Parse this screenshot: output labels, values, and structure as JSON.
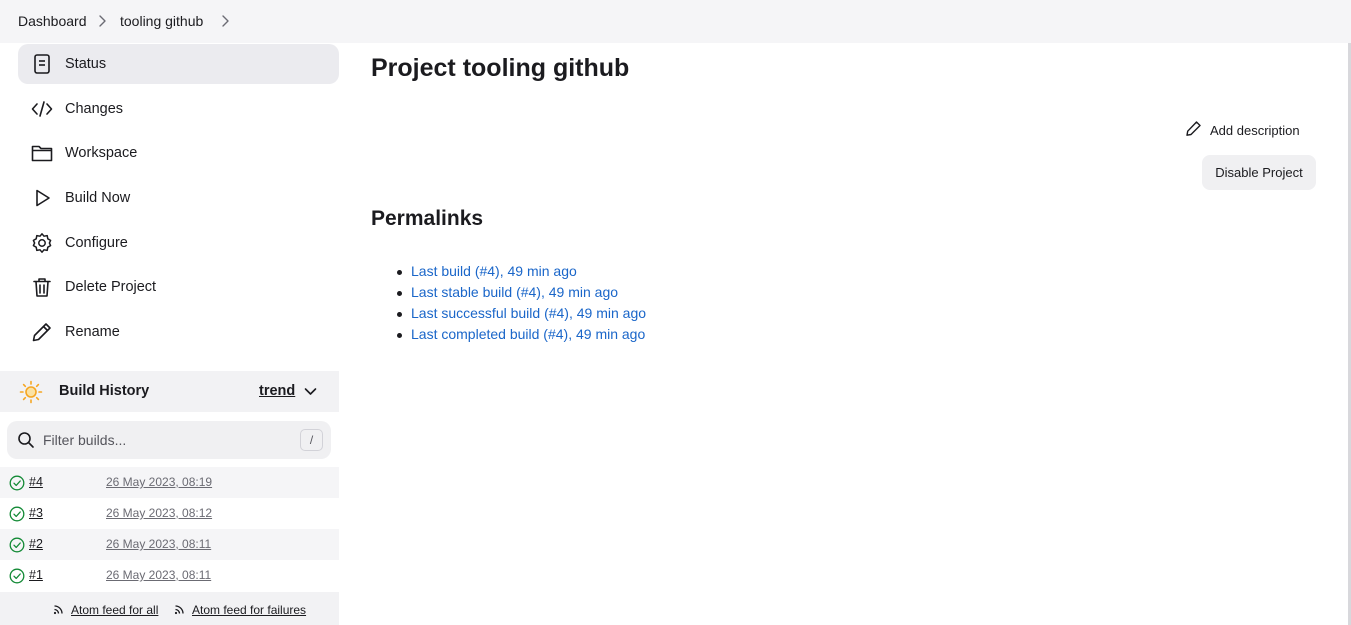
{
  "breadcrumb": {
    "items": [
      "Dashboard",
      "tooling github"
    ]
  },
  "sidebar": {
    "items": [
      {
        "label": "Status",
        "icon": "status-doc-icon",
        "active": true
      },
      {
        "label": "Changes",
        "icon": "code-icon"
      },
      {
        "label": "Workspace",
        "icon": "folder-icon"
      },
      {
        "label": "Build Now",
        "icon": "play-icon"
      },
      {
        "label": "Configure",
        "icon": "gear-icon"
      },
      {
        "label": "Delete Project",
        "icon": "trash-icon"
      },
      {
        "label": "Rename",
        "icon": "pencil-icon"
      }
    ]
  },
  "build_history": {
    "title": "Build History",
    "trend_label": "trend",
    "filter": {
      "placeholder": "Filter builds...",
      "shortcut": "/"
    },
    "builds": [
      {
        "number": "#4",
        "date": "26 May 2023, 08:19",
        "status": "success"
      },
      {
        "number": "#3",
        "date": "26 May 2023, 08:12",
        "status": "success"
      },
      {
        "number": "#2",
        "date": "26 May 2023, 08:11",
        "status": "success"
      },
      {
        "number": "#1",
        "date": "26 May 2023, 08:11",
        "status": "success"
      }
    ],
    "feeds": {
      "all": "Atom feed for all",
      "failures": "Atom feed for failures"
    }
  },
  "main": {
    "title": "Project tooling github",
    "add_description": "Add description",
    "disable_button": "Disable Project",
    "permalinks_title": "Permalinks",
    "permalinks": [
      "Last build (#4), 49 min ago",
      "Last stable build (#4), 49 min ago",
      "Last successful build (#4), 49 min ago",
      "Last completed build (#4), 49 min ago"
    ]
  },
  "colors": {
    "link": "#1a66c9",
    "success": "#138a36",
    "sun": "#f5a623",
    "topbar": "#f5f5f7"
  }
}
